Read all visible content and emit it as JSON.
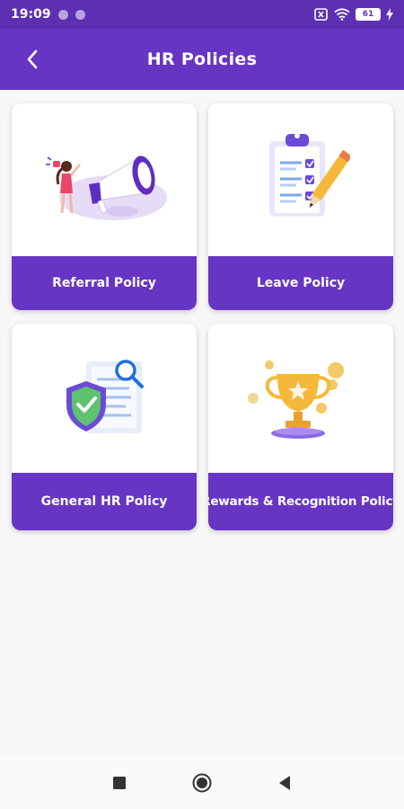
{
  "status_bar": {
    "time": "19:09",
    "battery": "61"
  },
  "app_bar": {
    "title": "HR Policies",
    "back_icon": "chevron-left-icon"
  },
  "cards": [
    {
      "label": "Referral Policy",
      "icon": "megaphone-illustration"
    },
    {
      "label": "Leave Policy",
      "icon": "clipboard-checklist-illustration"
    },
    {
      "label": "General HR Policy",
      "icon": "shield-document-illustration"
    },
    {
      "label": "Rewards & Recognition Policy",
      "icon": "trophy-illustration"
    }
  ],
  "colors": {
    "primary": "#6735c4",
    "status_bar": "#5c2fb3",
    "background": "#f7f7f7"
  },
  "nav_bar": {
    "buttons": [
      "square-icon",
      "circle-home-icon",
      "triangle-back-icon"
    ]
  }
}
